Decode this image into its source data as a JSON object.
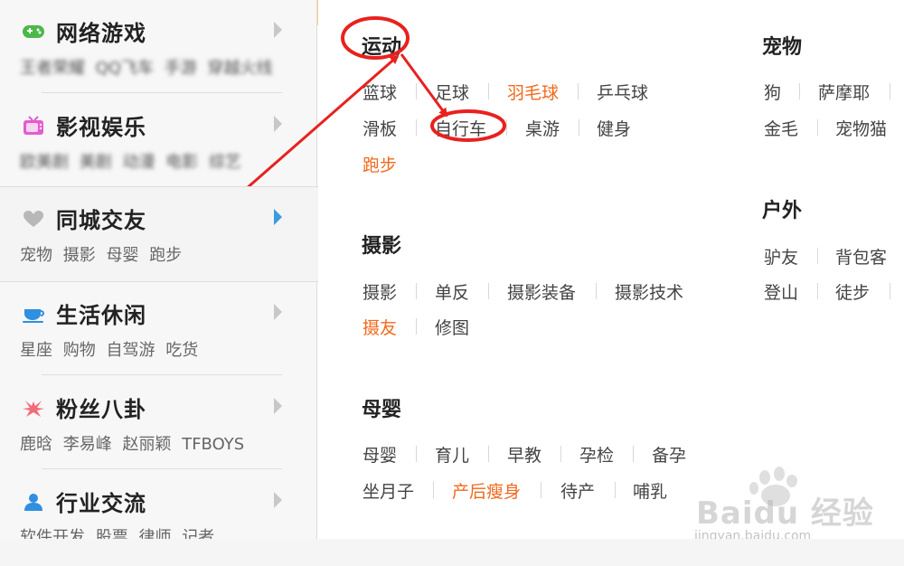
{
  "sidebar": {
    "categories": [
      {
        "title": "网络游戏",
        "sub": [
          "王者荣耀",
          "QQ飞车",
          "手游",
          "穿越火线"
        ],
        "icon": "gamepad-icon",
        "blurred": true
      },
      {
        "title": "影视娱乐",
        "sub": [
          "欧美剧",
          "美剧",
          "动漫",
          "电影",
          "综艺"
        ],
        "icon": "tv-icon",
        "blurred": true
      },
      {
        "title": "同城交友",
        "sub": [
          "宠物",
          "摄影",
          "母婴",
          "跑步"
        ],
        "icon": "heart-icon",
        "active": true
      },
      {
        "title": "生活休闲",
        "sub": [
          "星座",
          "购物",
          "自驾游",
          "吃货"
        ],
        "icon": "coffee-cup-icon"
      },
      {
        "title": "粉丝八卦",
        "sub": [
          "鹿晗",
          "李易峰",
          "赵丽颖",
          "TFBOYS"
        ],
        "icon": "star-burst-icon"
      },
      {
        "title": "行业交流",
        "sub": [
          "软件开发",
          "股票",
          "律师",
          "记者"
        ],
        "icon": "person-icon"
      }
    ]
  },
  "main": {
    "sections": {
      "sports": {
        "title": "运动",
        "row1": [
          "篮球",
          "足球",
          "羽毛球",
          "乒乓球"
        ],
        "row2": [
          "滑板",
          "自行车",
          "桌游",
          "健身"
        ],
        "row3": [
          "跑步"
        ]
      },
      "photo": {
        "title": "摄影",
        "row1": [
          "摄影",
          "单反",
          "摄影装备",
          "摄影技术"
        ],
        "row2": [
          "摄友",
          "修图"
        ]
      },
      "baby": {
        "title": "母婴",
        "row1": [
          "母婴",
          "育儿",
          "早教",
          "孕检",
          "备孕"
        ],
        "row2": [
          "坐月子",
          "产后瘦身",
          "待产",
          "哺乳"
        ]
      },
      "pets": {
        "title": "宠物",
        "row1": [
          "狗",
          "萨摩耶"
        ],
        "row2": [
          "金毛",
          "宠物猫"
        ]
      },
      "outdoor": {
        "title": "户外",
        "row1": [
          "驴友",
          "背包客"
        ],
        "row2": [
          "登山",
          "徒步"
        ]
      }
    },
    "highlight_color": "#f06a1c",
    "annotation_color": "#e8211f"
  },
  "watermark": {
    "brand": "Baidu 经验",
    "url": "jingyan.baidu.com"
  }
}
